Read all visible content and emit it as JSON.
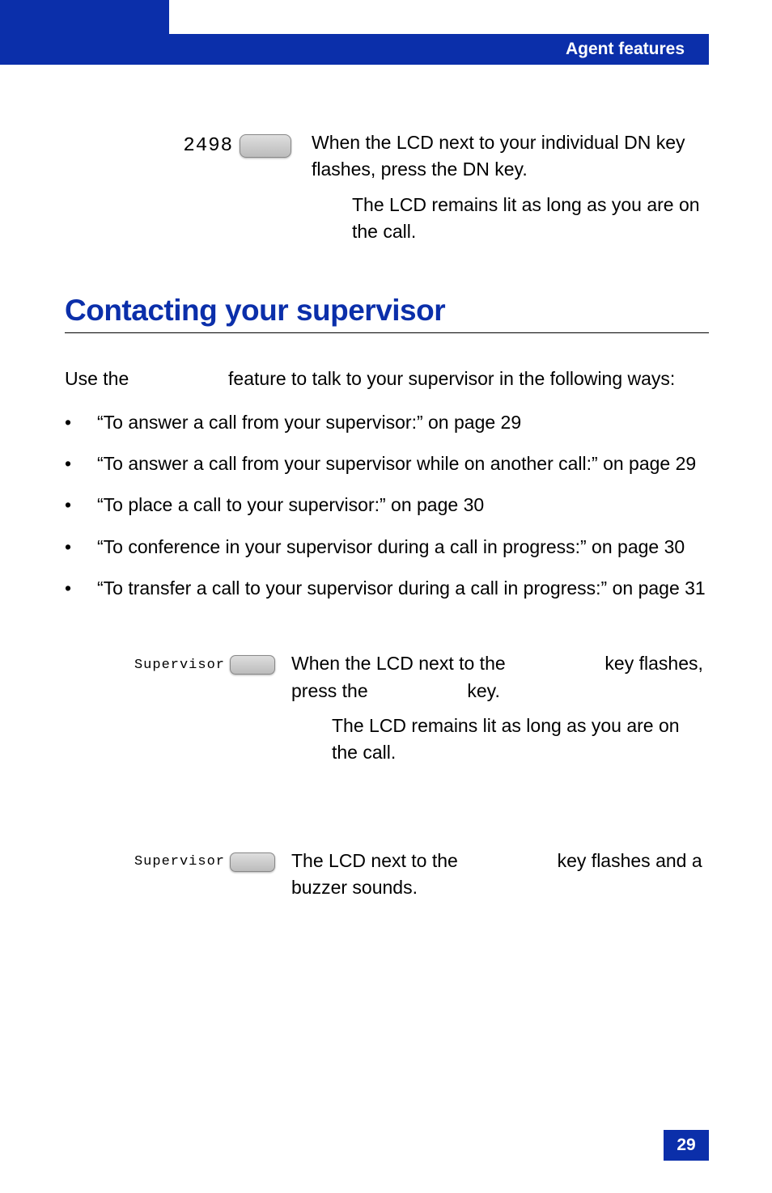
{
  "header": {
    "title": "Agent features"
  },
  "page_number": "29",
  "step1": {
    "key_label": "2498",
    "text": "When the LCD next to your individual DN key flashes, press the DN key.",
    "note": "The LCD remains lit as long as you are on the call."
  },
  "section_heading": "Contacting your supervisor",
  "intro": {
    "pre": "Use the ",
    "post": " feature to talk to your supervisor in the following ways:"
  },
  "toc": [
    "“To answer a call from your supervisor:” on page 29",
    "“To answer a call from your supervisor while on another call:” on page 29",
    "“To place a call to your supervisor:” on page 30",
    "“To conference in your supervisor during a call in progress:” on page 30",
    "“To transfer a call to your supervisor during a call in progress:” on page 31"
  ],
  "step2": {
    "key_label": "Supervisor",
    "text_a": "When the LCD next to the ",
    "text_b": " key flashes, press the ",
    "text_c": " key.",
    "note": "The LCD remains lit as long as you are on the call."
  },
  "step3": {
    "key_label": "Supervisor",
    "text_a": "The LCD next to the ",
    "text_b": " key flashes and a buzzer sounds."
  }
}
